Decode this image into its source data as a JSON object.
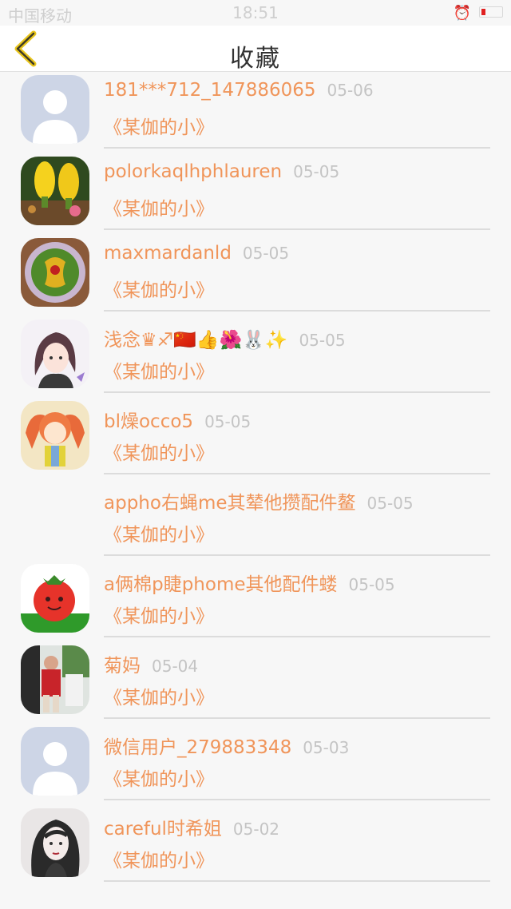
{
  "status_bar": {
    "carrier": "中国移动",
    "time": "18:51"
  },
  "header": {
    "title": "收藏"
  },
  "items": [
    {
      "name": "181***712_147886065",
      "date": "05-06",
      "subtitle": "《某伽的小》",
      "avatar": "default-avatar"
    },
    {
      "name": "polorkaqlhphlauren",
      "date": "05-05",
      "subtitle": "《某伽的小》",
      "avatar": "cactus-avatar"
    },
    {
      "name": "maxmardanld",
      "date": "05-05",
      "subtitle": "《某伽的小》",
      "avatar": "emblem-avatar"
    },
    {
      "name": "浅念♛♐🇨🇳👍🌺🐰✨",
      "date": "05-05",
      "subtitle": "《某伽的小》",
      "avatar": "anime-girl-avatar"
    },
    {
      "name": "bl燥occo5",
      "date": "05-05",
      "subtitle": "《某伽的小》",
      "avatar": "cartoon-girl-avatar"
    },
    {
      "name": "appho右蝇me其辇他攒配件鳌",
      "date": "05-05",
      "subtitle": "《某伽的小》",
      "avatar": "none"
    },
    {
      "name": "a俩棉p睫phome其他配件蝼",
      "date": "05-05",
      "subtitle": "《某伽的小》",
      "avatar": "tomato-avatar"
    },
    {
      "name": "菊妈",
      "date": "05-04",
      "subtitle": "《某伽的小》",
      "avatar": "photo-avatar"
    },
    {
      "name": "微信用户_279883348",
      "date": "05-03",
      "subtitle": "《某伽的小》",
      "avatar": "default-avatar"
    },
    {
      "name": "careful时希姐",
      "date": "05-02",
      "subtitle": "《某伽的小》",
      "avatar": "sketch-girl-avatar"
    }
  ],
  "colors": {
    "accent": "#f0955a",
    "date": "#c4c4c4",
    "divider": "#dcdcdc",
    "back_arrow": "#e8c51c"
  }
}
